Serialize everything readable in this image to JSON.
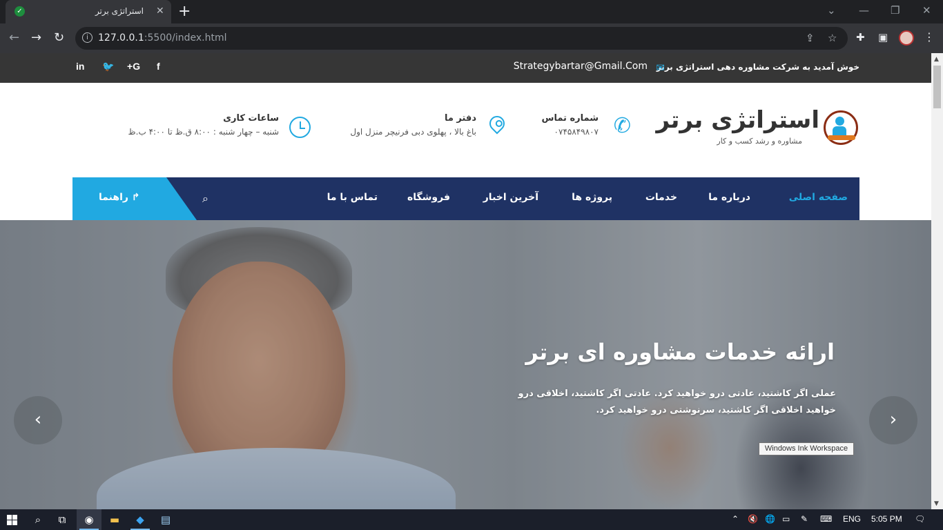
{
  "browser": {
    "tab_title": "استراتژی برتر",
    "tab_close": "✕",
    "new_tab": "+",
    "url_host": "127.0.0.1",
    "url_rest": ":5500/index.html",
    "icons": [
      "back-icon",
      "forward-icon",
      "reload-icon",
      "site-info-icon",
      "share-icon",
      "bookmark-star-icon",
      "extensions-icon",
      "side-panel-icon",
      "profile-avatar",
      "menu-icon"
    ]
  },
  "topbar": {
    "welcome": "خوش آمدید به شرکت مشاوره دهی استراتژی برتر",
    "email": "Strategybartar@Gmail.Com",
    "social": [
      "f",
      "G+",
      "twitter",
      "in"
    ]
  },
  "header": {
    "logo_title": "استراتژی برتر",
    "logo_subtitle": "مشاوره و رشد کسب و کار",
    "contact": {
      "title": "شماره تماس",
      "value": "۰۷۴۵۸۴۹۸۰۷"
    },
    "office": {
      "title": "دفتر ما",
      "value": "باغ بالا ، پهلوی دبی فرنیچر منزل اول"
    },
    "hours": {
      "title": "ساعات کاری",
      "value": "شنبه – چهار شنبه : ۸:۰۰ ق.ظ تا ۴:۰۰ ب.ظ"
    }
  },
  "nav": {
    "items": [
      "صفحه اصلی",
      "درباره ما",
      "خدمات",
      "پروژه ها",
      "آخرین اخبار",
      "فروشگاه",
      "تماس با ما"
    ],
    "active_index": 0,
    "guide_label": "راهنما"
  },
  "hero": {
    "title": "ارائه خدمات مشاوره ای برتر",
    "text": "عملی اگر کاشتید، عادتی درو خواهید کرد. عادتی اگر کاشتید، اخلاقی درو خواهید اخلاقی اگر کاشتید، سرنوشتی درو خواهید کرد.",
    "prev": "‹",
    "next": "›"
  },
  "tooltip": "Windows Ink Workspace",
  "taskbar": {
    "language": "ENG",
    "time": "5:05 PM"
  },
  "colors": {
    "accent": "#21a9e1",
    "navbar": "#1f3264",
    "topbar": "#363636"
  }
}
